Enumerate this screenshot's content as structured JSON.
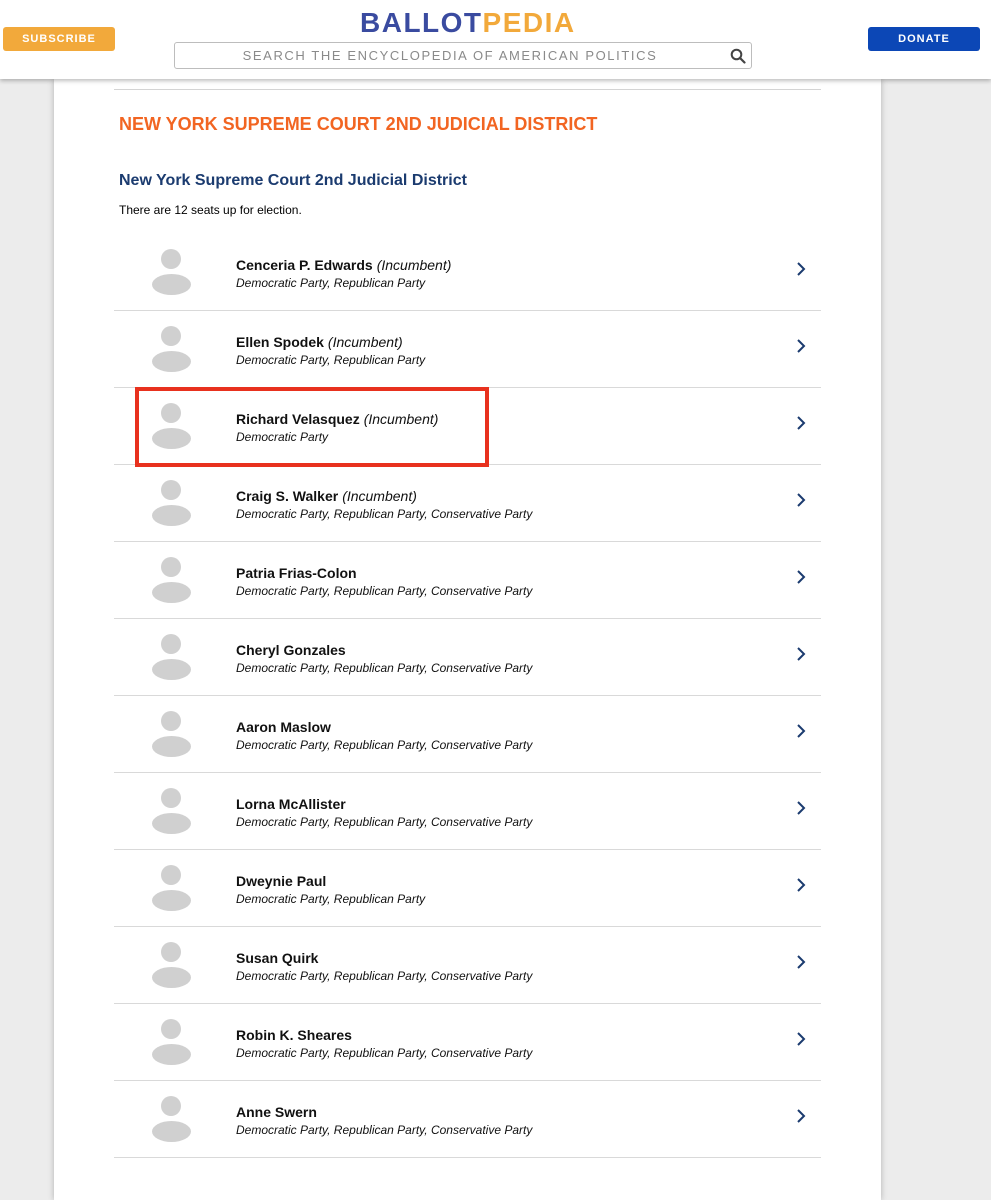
{
  "header": {
    "subscribe_label": "SUBSCRIBE",
    "donate_label": "DONATE",
    "logo_part1": "BALLOT",
    "logo_part2": "PEDIA",
    "search_placeholder": "SEARCH THE ENCYCLOPEDIA OF AMERICAN POLITICS",
    "colors": {
      "subscribe": "#f2a93b",
      "donate": "#0c47b6",
      "logo_blue": "#3a4ba0",
      "logo_orange": "#f2a93b"
    }
  },
  "page": {
    "title": "NEW YORK SUPREME COURT 2ND JUDICIAL DISTRICT",
    "section_title": "New York Supreme Court 2nd Judicial District",
    "seats_note": "There are 12 seats up for election.",
    "colors": {
      "title": "#f26522",
      "section_title": "#1b3b6f",
      "highlight": "#e8311e"
    }
  },
  "candidates": [
    {
      "name": "Cenceria P. Edwards",
      "incumbent": "(Incumbent)",
      "parties": "Democratic Party, Republican Party"
    },
    {
      "name": "Ellen Spodek",
      "incumbent": "(Incumbent)",
      "parties": "Democratic Party, Republican Party"
    },
    {
      "name": "Richard Velasquez",
      "incumbent": "(Incumbent)",
      "parties": "Democratic Party"
    },
    {
      "name": "Craig S. Walker",
      "incumbent": "(Incumbent)",
      "parties": "Democratic Party, Republican Party, Conservative Party"
    },
    {
      "name": "Patria Frias-Colon",
      "incumbent": "",
      "parties": "Democratic Party, Republican Party, Conservative Party"
    },
    {
      "name": "Cheryl Gonzales",
      "incumbent": "",
      "parties": "Democratic Party, Republican Party, Conservative Party"
    },
    {
      "name": "Aaron Maslow",
      "incumbent": "",
      "parties": "Democratic Party, Republican Party, Conservative Party"
    },
    {
      "name": "Lorna McAllister",
      "incumbent": "",
      "parties": "Democratic Party, Republican Party, Conservative Party"
    },
    {
      "name": "Dweynie Paul",
      "incumbent": "",
      "parties": "Democratic Party, Republican Party"
    },
    {
      "name": "Susan Quirk",
      "incumbent": "",
      "parties": "Democratic Party, Republican Party, Conservative Party"
    },
    {
      "name": "Robin K. Sheares",
      "incumbent": "",
      "parties": "Democratic Party, Republican Party, Conservative Party"
    },
    {
      "name": "Anne Swern",
      "incumbent": "",
      "parties": "Democratic Party, Republican Party, Conservative Party"
    }
  ],
  "icons": {
    "search": "search-icon",
    "row_arrow": "chevron-right-icon",
    "avatar": "person-placeholder-icon"
  }
}
